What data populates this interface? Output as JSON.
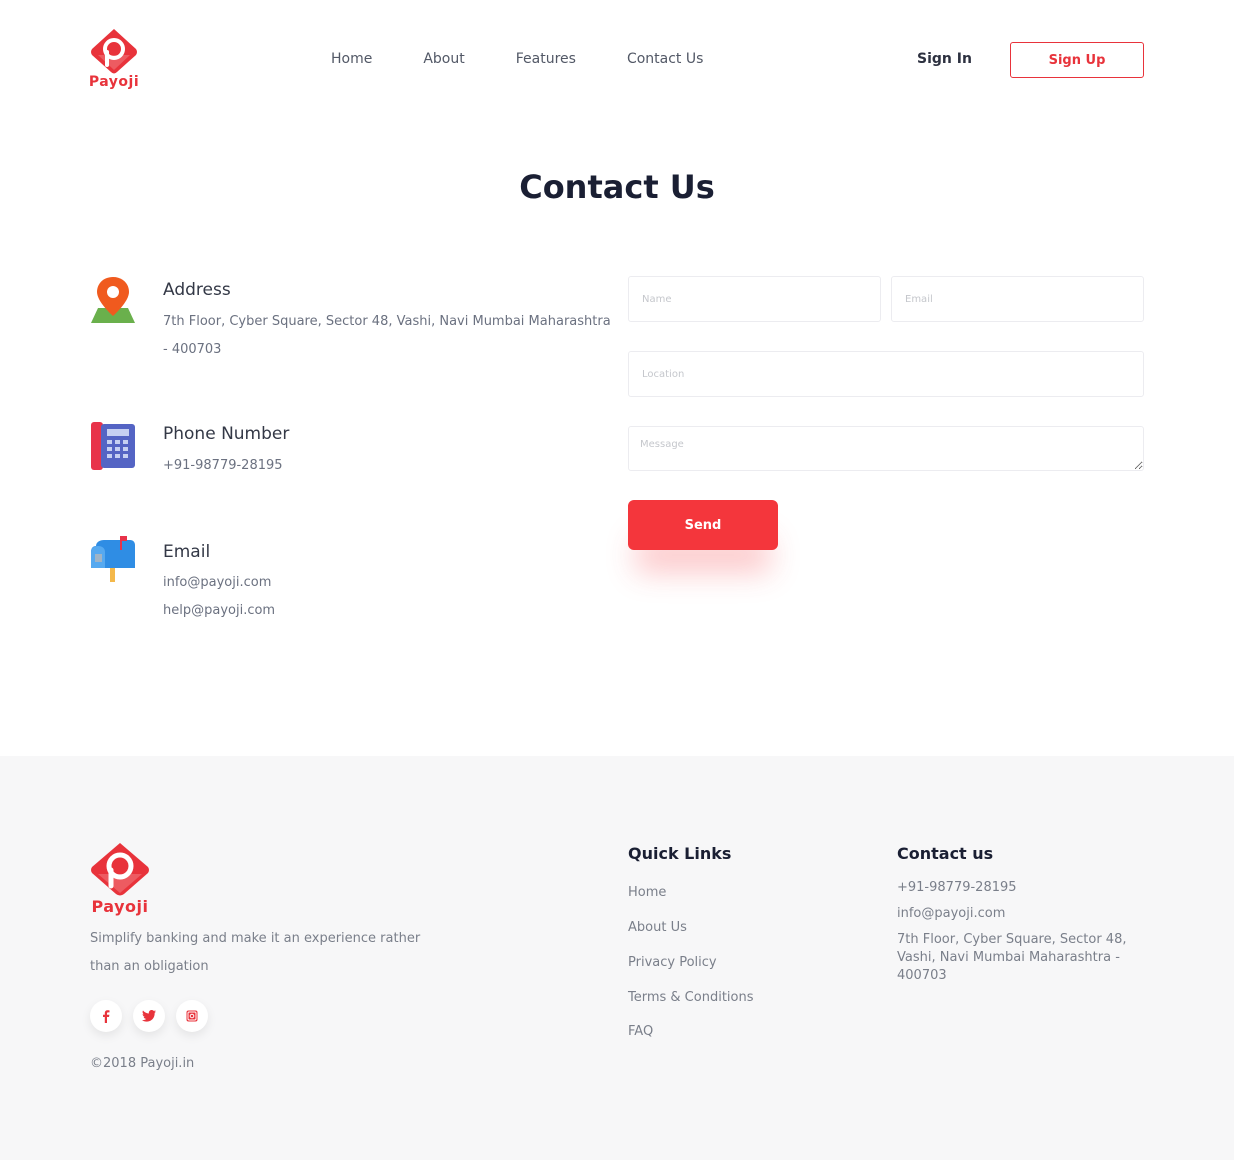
{
  "brand": {
    "name": "Payoji",
    "color": "#e8333b"
  },
  "nav": {
    "items": [
      "Home",
      "About",
      "Features",
      "Contact Us"
    ],
    "sign_in": "Sign In",
    "sign_up": "Sign Up"
  },
  "page": {
    "title": "Contact Us"
  },
  "contact_info": {
    "address": {
      "title": "Address",
      "line1": "7th Floor, Cyber Square, Sector 48, Vashi, Navi Mumbai Maharashtra",
      "line2": "- 400703",
      "icon": "map-pin-icon"
    },
    "phone": {
      "title": "Phone Number",
      "value": "+91-98779-28195",
      "icon": "telephone-icon"
    },
    "email": {
      "title": "Email",
      "value1": "info@payoji.com",
      "value2": "help@payoji.com",
      "icon": "mailbox-icon"
    }
  },
  "form": {
    "name_placeholder": "Name",
    "email_placeholder": "Email",
    "location_placeholder": "Location",
    "message_placeholder": "Message",
    "send_label": "Send",
    "accent": "#f4363c"
  },
  "footer": {
    "brand": "Payoji",
    "tagline": "Simplify banking and make it an experience rather than an obligation",
    "social": [
      "facebook-icon",
      "twitter-icon",
      "instagram-icon"
    ],
    "copyright": "©2018 Payoji.in",
    "quick_links": {
      "title": "Quick Links",
      "items": [
        "Home",
        "About Us",
        "Privacy Policy",
        "Terms & Conditions",
        "FAQ"
      ]
    },
    "contact": {
      "title": "Contact us",
      "phone": "+91-98779-28195",
      "email": "info@payoji.com",
      "address": "7th Floor, Cyber Square, Sector 48, Vashi, Navi Mumbai Maharashtra - 400703"
    }
  }
}
